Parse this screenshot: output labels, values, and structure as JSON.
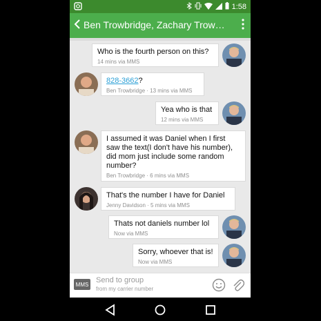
{
  "status": {
    "left": "▣",
    "time": "1:58"
  },
  "header": {
    "title": "Ben Trowbridge, Zachary Trowbr…"
  },
  "messages": [
    {
      "side": "out",
      "text": "Who is the fourth person on this?",
      "meta": "14 mins via MMS"
    },
    {
      "side": "in",
      "link": "828-3662",
      "text": "?",
      "meta": "Ben Trowbridge · 13 mins via MMS"
    },
    {
      "side": "out",
      "text": "Yea who is that",
      "meta": "12 mins via MMS"
    },
    {
      "side": "in",
      "text": "I assumed it was Daniel when I first saw the text(I don't have his number), did mom just include some random number?",
      "meta": "Ben Trowbridge · 6 mins via MMS"
    },
    {
      "side": "in",
      "text": "That's the number I have for Daniel",
      "meta": "Jenny Davidson · 5 mins via MMS"
    },
    {
      "side": "out",
      "text": "Thats not daniels number lol",
      "meta": "Now via MMS"
    },
    {
      "side": "out",
      "text": "Sorry, whoever that is!",
      "meta": "Now via MMS"
    }
  ],
  "composer": {
    "badge": "MMS",
    "placeholder": "Send to group",
    "subtext": "from my carrier number"
  },
  "colors": {
    "appbar": "#4cae4c",
    "statusbar": "#3c8a2d"
  }
}
